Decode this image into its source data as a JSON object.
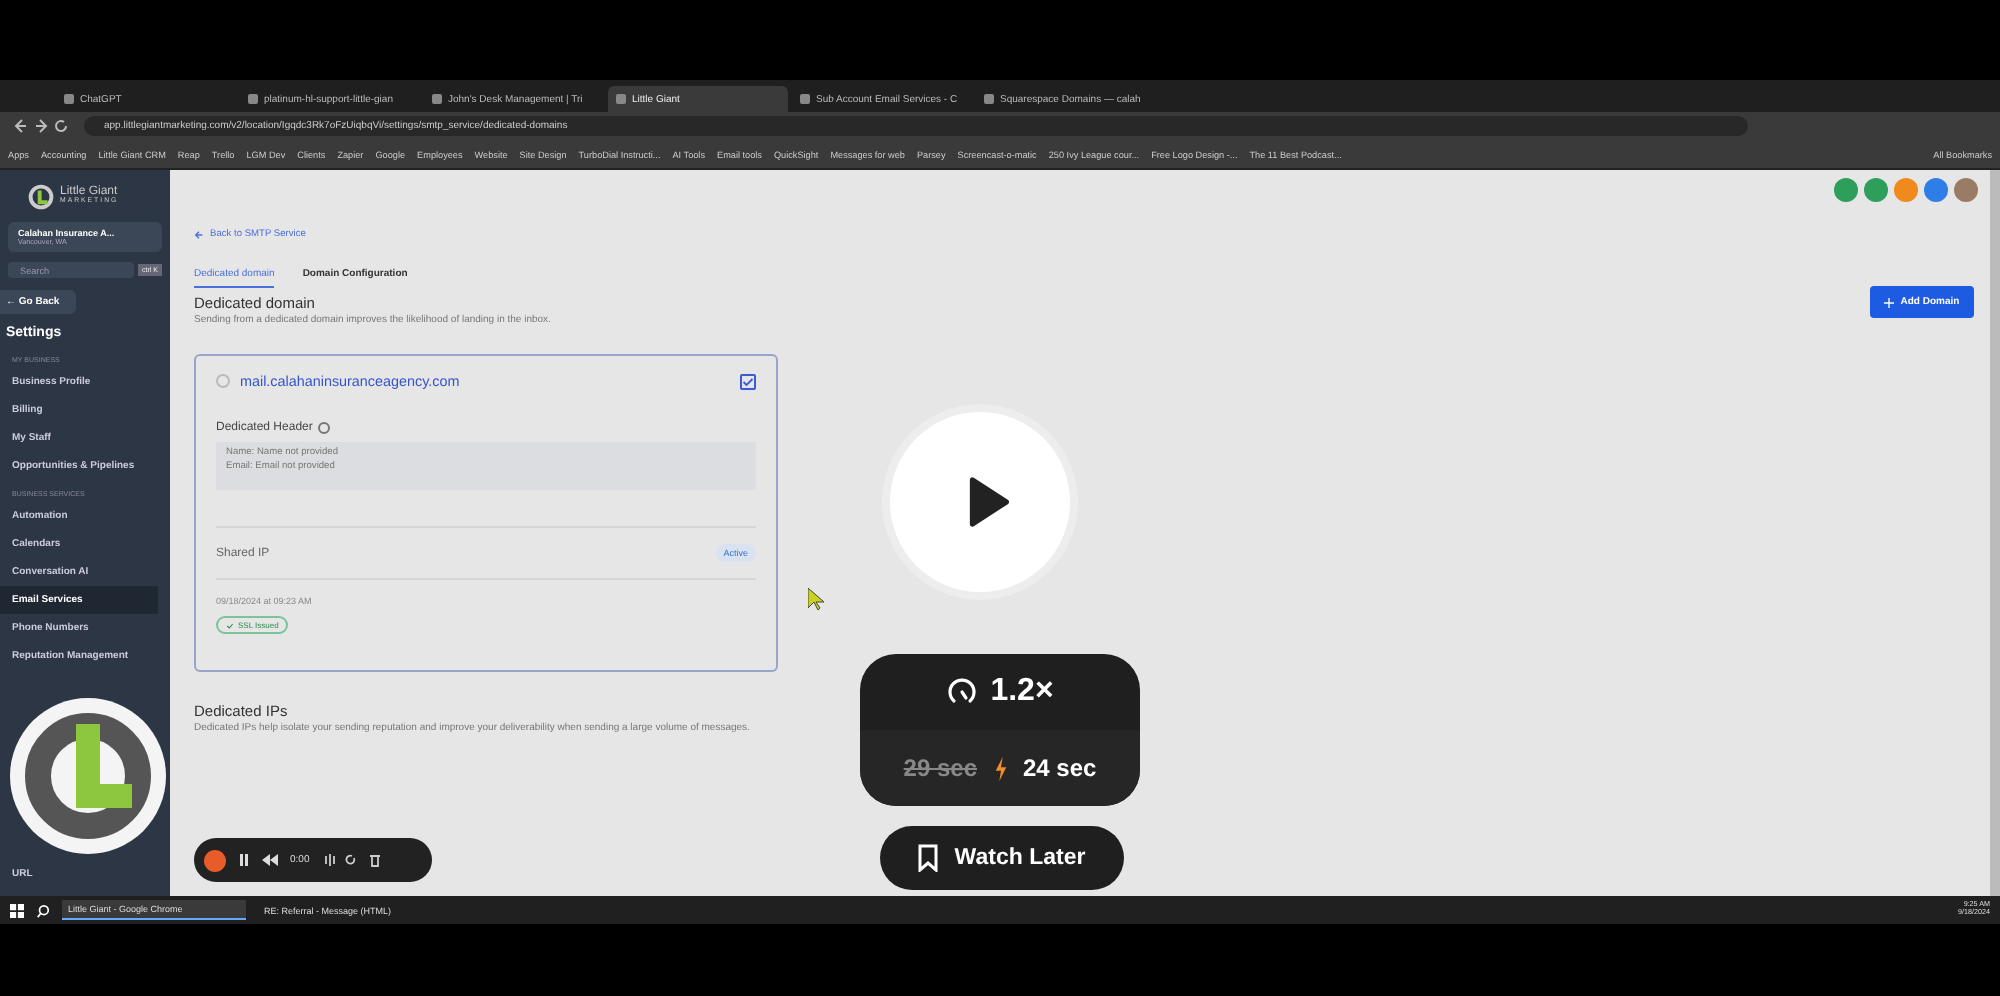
{
  "browser": {
    "tabs": [
      {
        "label": "ChatGPT",
        "selected": false
      },
      {
        "label": "platinum-hl-support-little-gian",
        "selected": false
      },
      {
        "label": "John's Desk Management | Tri",
        "selected": false
      },
      {
        "label": "Little Giant",
        "selected": true
      },
      {
        "label": "Sub Account Email Services - C",
        "selected": false
      },
      {
        "label": "Squarespace Domains — calah",
        "selected": false
      }
    ],
    "address": "app.littlegiantmarketing.com/v2/location/Igqdc3Rk7oFzUiqbqVi/settings/smtp_service/dedicated-domains",
    "bookmarks": [
      "Apps",
      "Accounting",
      "Little Giant CRM",
      "Reap",
      "Trello",
      "LGM Dev",
      "Clients",
      "Zapier",
      "Google",
      "Employees",
      "Website",
      "Site Design",
      "TurboDial Instructi...",
      "AI Tools",
      "Email tools",
      "QuickSight",
      "Messages for web",
      "Parsey",
      "Screencast-o-matic",
      "250 Ivy League cour...",
      "Free Logo Design -...",
      "The 11 Best Podcast..."
    ],
    "all_bookmarks": "All Bookmarks"
  },
  "sidebar": {
    "logo_title": "Little Giant",
    "logo_subtitle": "MARKETING",
    "account": {
      "name": "Calahan Insurance A...",
      "location": "Vancouver, WA"
    },
    "search": {
      "placeholder": "Search",
      "shortcut": "ctrl K"
    },
    "go_back": "← Go Back",
    "title": "Settings",
    "sections": [
      {
        "heading": "MY BUSINESS",
        "items": [
          {
            "label": "Business Profile",
            "selected": false
          },
          {
            "label": "Billing",
            "selected": false
          },
          {
            "label": "My Staff",
            "selected": false
          },
          {
            "label": "Opportunities & Pipelines",
            "selected": false
          }
        ]
      },
      {
        "heading": "BUSINESS SERVICES",
        "items": [
          {
            "label": "Automation",
            "selected": false
          },
          {
            "label": "Calendars",
            "selected": false
          },
          {
            "label": "Conversation AI",
            "selected": false
          },
          {
            "label": "Email Services",
            "selected": true
          },
          {
            "label": "Phone Numbers",
            "selected": false
          },
          {
            "label": "Reputation Management",
            "selected": false
          }
        ]
      }
    ],
    "last_item": "URL"
  },
  "main": {
    "back_link": "Back to SMTP Service",
    "tabs": [
      {
        "label": "Dedicated domain",
        "selected": true
      },
      {
        "label": "Domain Configuration",
        "selected": false
      }
    ],
    "heading": "Dedicated domain",
    "description": "Sending from a dedicated domain improves the likelihood of landing in the inbox.",
    "add_button": "Add Domain",
    "domain_card": {
      "domain": "mail.calahaninsuranceagency.com",
      "checked": true,
      "header_label": "Dedicated Header",
      "header_lines": [
        "Name: Name not provided",
        "Email: Email not provided"
      ],
      "ip_label": "Shared IP",
      "ip_status": "Active",
      "date": "09/18/2024 at 09:23 AM",
      "ssl": "SSL Issued"
    },
    "ips_heading": "Dedicated IPs",
    "ips_description": "Dedicated IPs help isolate your sending reputation and improve your deliverability when sending a large volume of messages."
  },
  "taskbar": {
    "apps": [
      {
        "label": "Little Giant - Google Chrome",
        "selected": true
      },
      {
        "label": "RE: Referral - Message (HTML)",
        "selected": false
      }
    ],
    "time": "9:25 AM",
    "date": "9/18/2024"
  },
  "player": {
    "speed": "1.2×",
    "old_duration": "29 sec",
    "new_duration": "24 sec",
    "watch_later": "Watch Later",
    "recorder_time": "0:00"
  }
}
